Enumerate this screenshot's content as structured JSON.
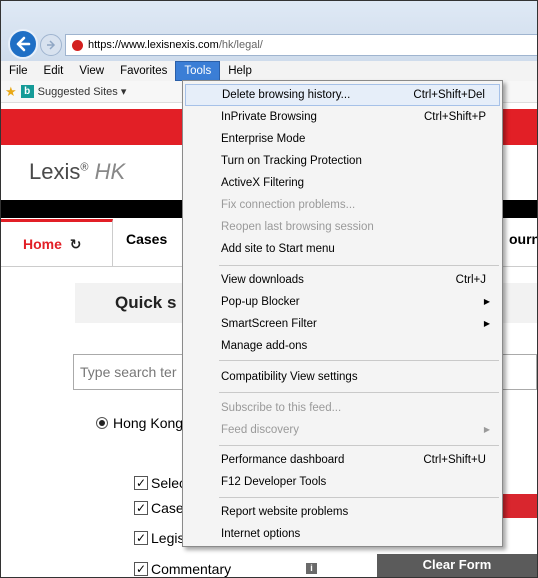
{
  "browser": {
    "url_host": "https://www.lexisnexis.com",
    "url_path": "/hk/legal/",
    "menu": [
      "File",
      "Edit",
      "View",
      "Favorites",
      "Tools",
      "Help"
    ],
    "favorites": {
      "suggested_sites": "Suggested Sites ▾"
    }
  },
  "page": {
    "logo_text": "Lexis",
    "logo_mark": "®",
    "logo_region": "HK",
    "tabs": {
      "home": "Home",
      "cases": "Cases",
      "journals": "ourn"
    },
    "quick_search_title": "Quick s",
    "search_placeholder": "Type search ter",
    "radio_label": "Hong Kong",
    "checkboxes": [
      {
        "label": "Selec",
        "checked": true
      },
      {
        "label": "Cases",
        "checked": true
      },
      {
        "label": "Legis",
        "checked": true
      },
      {
        "label": "Commentary",
        "checked": true
      }
    ],
    "clear_form": "Clear Form"
  },
  "tools_menu": {
    "items": [
      {
        "label": "Delete browsing history...",
        "shortcut": "Ctrl+Shift+Del",
        "highlighted": true
      },
      {
        "label": "InPrivate Browsing",
        "shortcut": "Ctrl+Shift+P"
      },
      {
        "label": "Enterprise Mode"
      },
      {
        "label": "Turn on Tracking Protection"
      },
      {
        "label": "ActiveX Filtering"
      },
      {
        "label": "Fix connection problems...",
        "disabled": true
      },
      {
        "label": "Reopen last browsing session",
        "disabled": true
      },
      {
        "label": "Add site to Start menu"
      },
      {
        "label": "View downloads",
        "shortcut": "Ctrl+J"
      },
      {
        "label": "Pop-up Blocker",
        "submenu": true
      },
      {
        "label": "SmartScreen Filter",
        "submenu": true
      },
      {
        "label": "Manage add-ons"
      },
      {
        "label": "Compatibility View settings"
      },
      {
        "label": "Subscribe to this feed...",
        "disabled": true
      },
      {
        "label": "Feed discovery",
        "disabled": true,
        "submenu": true
      },
      {
        "label": "Performance dashboard",
        "shortcut": "Ctrl+Shift+U"
      },
      {
        "label": "F12 Developer Tools"
      },
      {
        "label": "Report website problems"
      },
      {
        "label": "Internet options"
      }
    ]
  }
}
